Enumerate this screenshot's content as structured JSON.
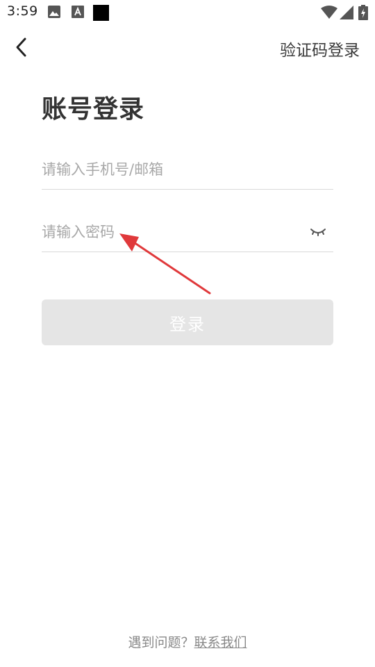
{
  "status_bar": {
    "time": "3:59",
    "icons": [
      "gallery-icon",
      "font-icon",
      "black-square-icon",
      "wifi-icon",
      "signal-icon",
      "battery-icon"
    ]
  },
  "header": {
    "back_icon": "chevron-left-icon",
    "switch_label": "验证码登录"
  },
  "title": "账号登录",
  "form": {
    "account_placeholder": "请输入手机号/邮箱",
    "account_value": "",
    "password_placeholder": "请输入密码",
    "password_value": "",
    "password_toggle_icon": "eye-closed-icon",
    "submit_label": "登录",
    "submit_color": "#e5e5e5"
  },
  "footer": {
    "question": "遇到问题？",
    "contact_link": "联系我们"
  },
  "annotation": {
    "arrow_color": "#e0393b",
    "arrow_icon": "red-arrow-icon"
  }
}
